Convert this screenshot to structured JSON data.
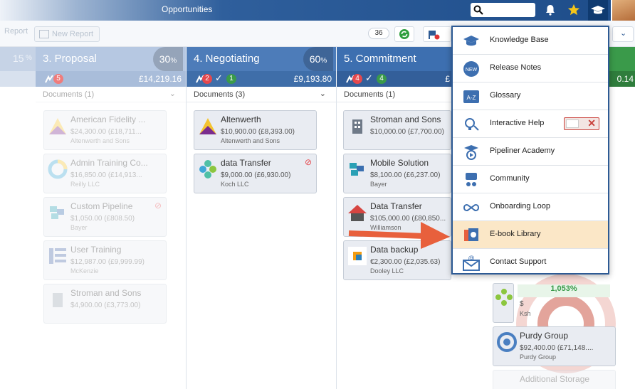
{
  "topbar": {
    "title": "Opportunities",
    "search_placeholder": ""
  },
  "toolbar": {
    "report_label": "Report",
    "new_report_label": "New Report",
    "count": "36"
  },
  "columns": [
    {
      "name": "3. Proposal",
      "pct": "30",
      "pct_sign": "%",
      "amount": "£14,219.16",
      "badges": [
        "5"
      ],
      "documents": "Documents (1)"
    },
    {
      "name": "4. Negotiating",
      "pct": "60",
      "pct_sign": "%",
      "amount": "£9,193.80",
      "badges": [
        "2",
        "1"
      ],
      "documents": "Documents (3)"
    },
    {
      "name": "5. Commitment",
      "pct": "",
      "pct_sign": "",
      "amount": "£",
      "badges": [
        "4",
        "4"
      ],
      "documents": "Documents (1)"
    }
  ],
  "left_partial": {
    "pct": "15",
    "pct_sign": "%"
  },
  "right_partial": {
    "amount": "0.14",
    "pct": "1,053%"
  },
  "cards_col3": [
    {
      "title": "American Fidelity ...",
      "value": "$24,300.00 (£18,711...",
      "company": "Altenwerth and Sons"
    },
    {
      "title": "Admin Training Co...",
      "value": "$16,850.00 (£14,913...",
      "company": "Reilly LLC"
    },
    {
      "title": "Custom Pipeline",
      "value": "$1,050.00 (£808.50)",
      "company": "Bayer"
    },
    {
      "title": "User Training",
      "value": "$12,987.00 (£9,999.99)",
      "company": "McKenzie"
    },
    {
      "title": "Stroman and Sons",
      "value": "$4,900.00 (£3,773.00)",
      "company": ""
    }
  ],
  "cards_col4": [
    {
      "title": "Altenwerth",
      "value": "$10,900.00 (£8,393.00)",
      "company": "Altenwerth and Sons"
    },
    {
      "title": "data Transfer",
      "value": "$9,000.00 (£6,930.00)",
      "company": "Koch LLC"
    }
  ],
  "cards_col5": [
    {
      "title": "Stroman and Sons",
      "value": "$10,000.00 (£7,700.00)",
      "company": ""
    },
    {
      "title": "Mobile Solution",
      "value": "$8,100.00 (£6,237.00)",
      "company": "Bayer"
    },
    {
      "title": "Data Transfer",
      "value": "$105,000.00 (£80,850...",
      "company": "Williamson"
    },
    {
      "title": "Data backup",
      "value": "€2,300.00 (£2,035.63)",
      "company": "Dooley LLC"
    }
  ],
  "cards_col6": [
    {
      "title": "Purdy Group",
      "value": "$92,400.00 (£71,148....",
      "company": "Purdy Group"
    },
    {
      "title": "Additional Storage",
      "value": "",
      "company": ""
    },
    {
      "title": "",
      "value": "$",
      "company": "Ksh"
    }
  ],
  "menu": {
    "items": [
      {
        "label": "Knowledge Base"
      },
      {
        "label": "Release Notes"
      },
      {
        "label": "Glossary"
      },
      {
        "label": "Interactive Help"
      },
      {
        "label": "Pipeliner Academy"
      },
      {
        "label": "Community"
      },
      {
        "label": "Onboarding Loop"
      },
      {
        "label": "E-book Library"
      },
      {
        "label": "Contact Support"
      }
    ]
  },
  "colors": {
    "header_blue": "#1d4c89",
    "column_blue": "#5d86bd",
    "highlight": "#fbe7c7",
    "arrow": "#e8603c"
  }
}
